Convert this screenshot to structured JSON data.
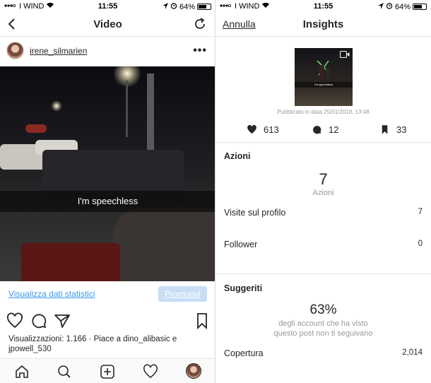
{
  "status_left": {
    "carrier": "I WIND",
    "time": "11:55",
    "battery": "64%"
  },
  "status_right": {
    "carrier": "I WIND",
    "time": "11:55",
    "battery": "64%"
  },
  "video_screen": {
    "nav_title": "Video",
    "username": "irene_silmarien",
    "more_label": "•••",
    "video_caption": "I'm speechless",
    "stats_link": "Visualizza dati statistici",
    "promote_button": "Promuovi",
    "views_line": "Visualizzazioni: 1.166 · Piace a dino_alibasic e jpowell_530"
  },
  "insights_screen": {
    "cancel": "Annulla",
    "nav_title": "Insights",
    "thumb_caption": "I'm speechless",
    "published": "Pubblicato in data 25/01/2018, 13:48",
    "likes": "613",
    "comments": "12",
    "saves": "33",
    "actions": {
      "title": "Azioni",
      "total": "7",
      "total_label": "Azioni",
      "rows": [
        {
          "label": "Visite sul profilo",
          "value": "7"
        },
        {
          "label": "Follower",
          "value": "0"
        }
      ]
    },
    "suggested": {
      "title": "Suggeriti",
      "percent": "63%",
      "percent_desc_line1": "degli account che ha visto",
      "percent_desc_line2": "questo post non ti seguivano",
      "rows": [
        {
          "label": "Copertura",
          "value": "2,014"
        }
      ]
    }
  },
  "colors": {
    "link_blue": "#3897f0",
    "promote_bg": "#c7def6",
    "muted_gray": "#999999"
  }
}
